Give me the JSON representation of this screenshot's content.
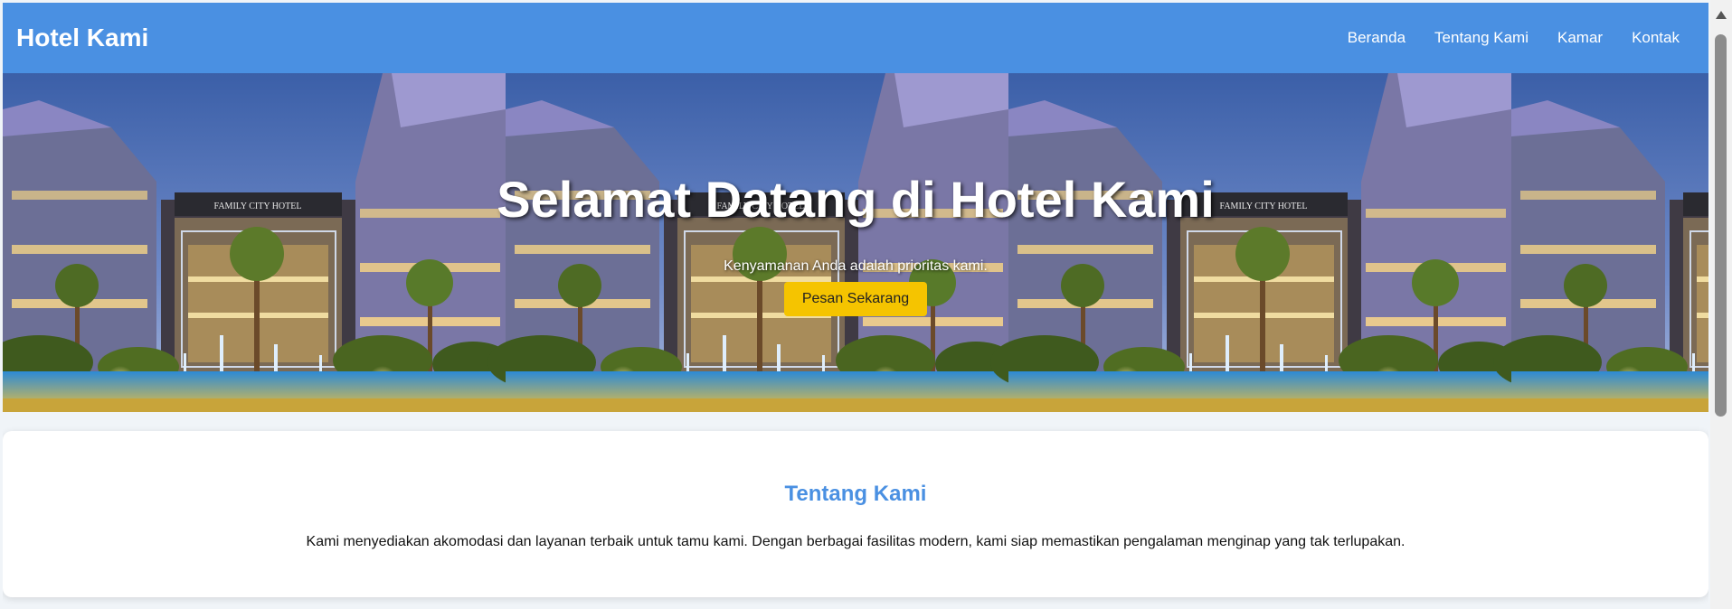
{
  "header": {
    "brand": "Hotel Kami",
    "nav": [
      "Beranda",
      "Tentang Kami",
      "Kamar",
      "Kontak"
    ]
  },
  "hero": {
    "title": "Selamat Datang di Hotel Kami",
    "subtitle": "Kenyamanan Anda adalah prioritas kami.",
    "button_label": "Pesan Sekarang",
    "sign_text": "FAMILY CITY HOTEL"
  },
  "about": {
    "heading": "Tentang Kami",
    "text": "Kami menyediakan akomodasi dan layanan terbaik untuk tamu kami. Dengan berbagai fasilitas modern, kami siap memastikan pengalaman menginap yang tak terlupakan."
  },
  "colors": {
    "accent": "#4a90e2",
    "button": "#f5c400",
    "background": "#f0f4f8"
  }
}
